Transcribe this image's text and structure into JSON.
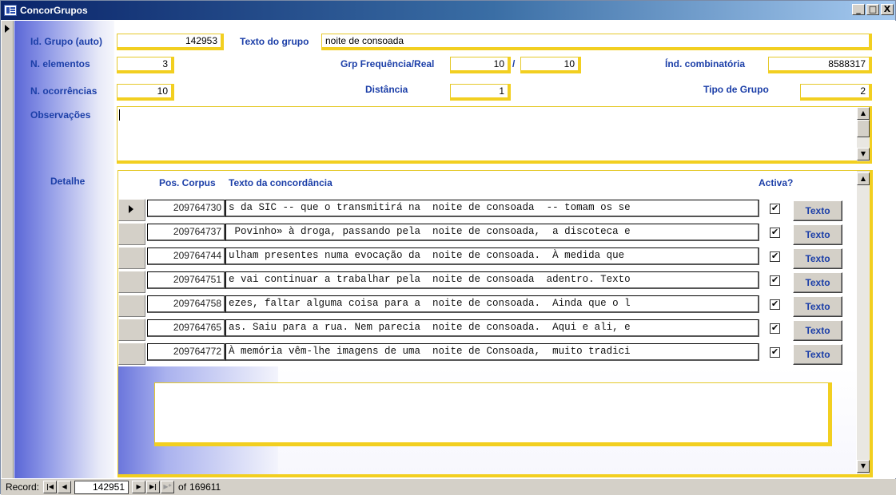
{
  "window": {
    "title": "ConcorGrupos",
    "controls": {
      "minimize": "_",
      "maximize": "□",
      "close": "X"
    }
  },
  "form": {
    "id_grupo": {
      "label": "Id. Grupo (auto)",
      "value": "142953"
    },
    "texto_grupo": {
      "label": "Texto do grupo",
      "value": "noite de consoada"
    },
    "n_elementos": {
      "label": "N. elementos",
      "value": "3"
    },
    "grp_frequencia": {
      "label": "Grp Frequência/Real",
      "value1": "10",
      "separator": "/",
      "value2": "10"
    },
    "ind_combinatoria": {
      "label": "Índ. combinatória",
      "value": "8588317"
    },
    "n_ocorrencias": {
      "label": "N. ocorrências",
      "value": "10"
    },
    "distancia": {
      "label": "Distância",
      "value": "1"
    },
    "tipo_grupo": {
      "label": "Tipo de Grupo",
      "value": "2"
    },
    "observacoes": {
      "label": "Observações",
      "value": ""
    },
    "detalhe": {
      "label": "Detalhe"
    }
  },
  "subform": {
    "headers": {
      "pos": "Pos. Corpus",
      "texto": "Texto da concordância",
      "activa": "Activa?"
    },
    "button_label": "Texto",
    "check_mark": "✔",
    "rows": [
      {
        "pos": "209764730",
        "texto": "s da SIC -- que o transmitirá na  noite de consoada  -- tomam os se",
        "activa": true
      },
      {
        "pos": "209764737",
        "texto": " Povinho» à droga, passando pela  noite de consoada,  a discoteca e",
        "activa": true
      },
      {
        "pos": "209764744",
        "texto": "ulham presentes numa evocação da  noite de consoada.  À medida que",
        "activa": true
      },
      {
        "pos": "209764751",
        "texto": "e vai continuar a trabalhar pela  noite de consoada  adentro. Texto",
        "activa": true
      },
      {
        "pos": "209764758",
        "texto": "ezes, faltar alguma coisa para a  noite de consoada.  Ainda que o l",
        "activa": true
      },
      {
        "pos": "209764765",
        "texto": "as. Saiu para a rua. Nem parecia  noite de consoada.  Aqui e ali, e",
        "activa": true
      },
      {
        "pos": "209764772",
        "texto": "À memória vêm-lhe imagens de uma  noite de Consoada,  muito tradici",
        "activa": true
      }
    ]
  },
  "navigation": {
    "label": "Record:",
    "first": "|◀",
    "prev": "◀",
    "current": "142951",
    "next": "▶",
    "last": "▶|",
    "new": "▶*",
    "of_label": "of",
    "total": "169611"
  }
}
